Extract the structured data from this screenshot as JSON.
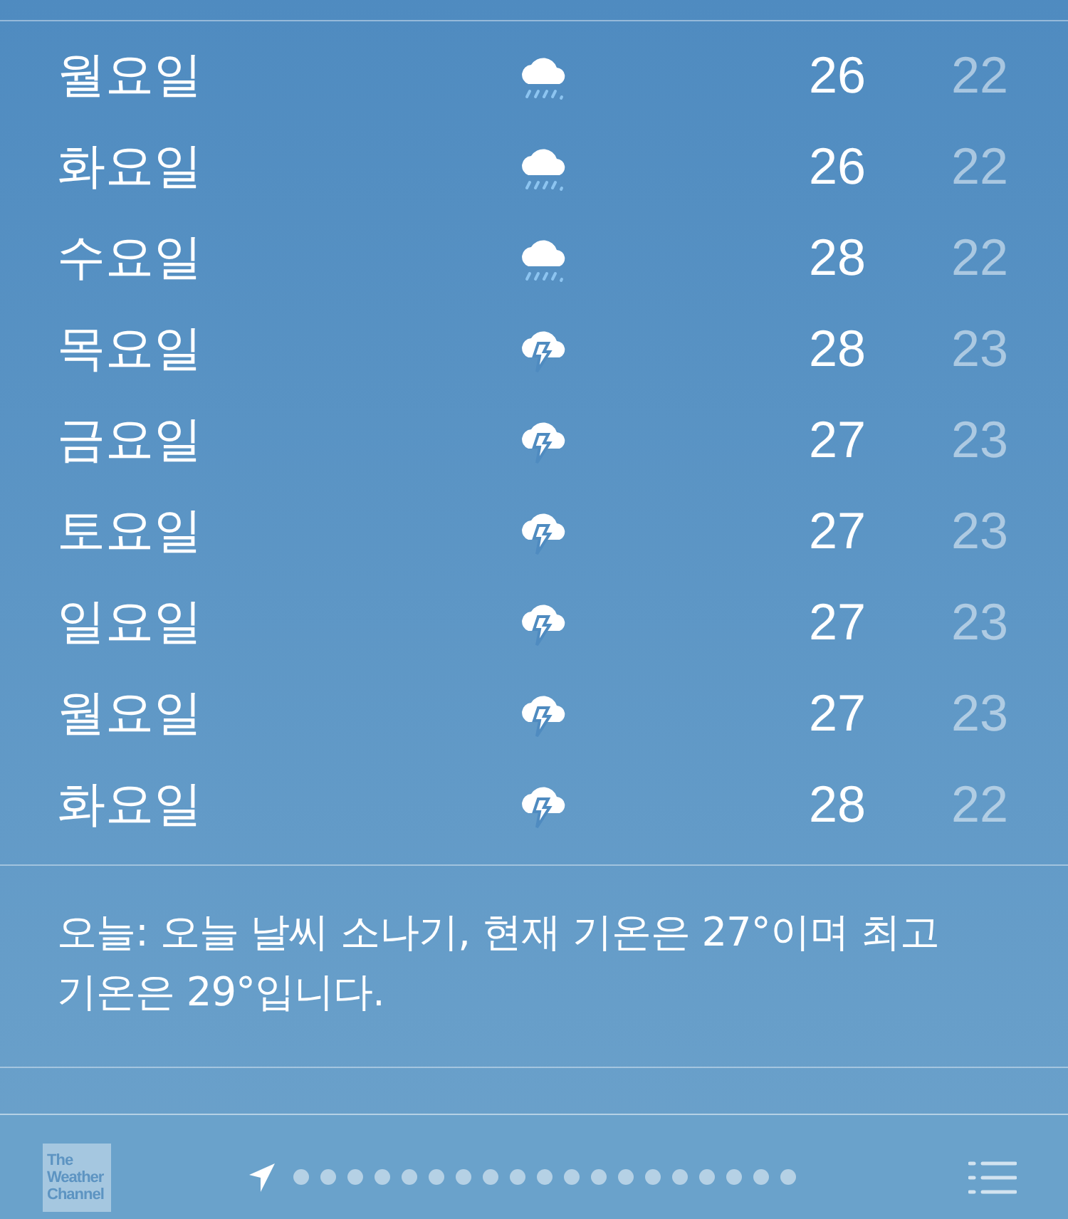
{
  "forecast": [
    {
      "day": "월요일",
      "kind": "rain",
      "high": "26",
      "low": "22"
    },
    {
      "day": "화요일",
      "kind": "rain",
      "high": "26",
      "low": "22"
    },
    {
      "day": "수요일",
      "kind": "rain",
      "high": "28",
      "low": "22"
    },
    {
      "day": "목요일",
      "kind": "thunderstorm",
      "high": "28",
      "low": "23"
    },
    {
      "day": "금요일",
      "kind": "thunderstorm",
      "high": "27",
      "low": "23"
    },
    {
      "day": "토요일",
      "kind": "thunderstorm",
      "high": "27",
      "low": "23"
    },
    {
      "day": "일요일",
      "kind": "thunderstorm",
      "high": "27",
      "low": "23"
    },
    {
      "day": "월요일",
      "kind": "thunderstorm",
      "high": "27",
      "low": "23"
    },
    {
      "day": "화요일",
      "kind": "thunderstorm",
      "high": "28",
      "low": "22"
    }
  ],
  "summary": "오늘: 오늘 날씨 소나기, 현재 기온은 27°이며 최고 기온은 29°입니다.",
  "footer": {
    "logo": [
      "The",
      "Weather",
      "Channel"
    ],
    "pages": [
      {
        "kind": "location",
        "selected": true
      },
      {
        "kind": "dot",
        "selected": false
      },
      {
        "kind": "dot",
        "selected": false
      },
      {
        "kind": "dot",
        "selected": false
      },
      {
        "kind": "dot",
        "selected": false
      },
      {
        "kind": "dot",
        "selected": false
      },
      {
        "kind": "dot",
        "selected": false
      },
      {
        "kind": "dot",
        "selected": false
      },
      {
        "kind": "dot",
        "selected": false
      },
      {
        "kind": "dot",
        "selected": false
      },
      {
        "kind": "dot",
        "selected": false
      },
      {
        "kind": "dot",
        "selected": false
      },
      {
        "kind": "dot",
        "selected": false
      },
      {
        "kind": "dot",
        "selected": false
      },
      {
        "kind": "dot",
        "selected": false
      },
      {
        "kind": "dot",
        "selected": false
      },
      {
        "kind": "dot",
        "selected": false
      },
      {
        "kind": "dot",
        "selected": false
      },
      {
        "kind": "dot",
        "selected": false
      },
      {
        "kind": "dot",
        "selected": false
      }
    ]
  }
}
